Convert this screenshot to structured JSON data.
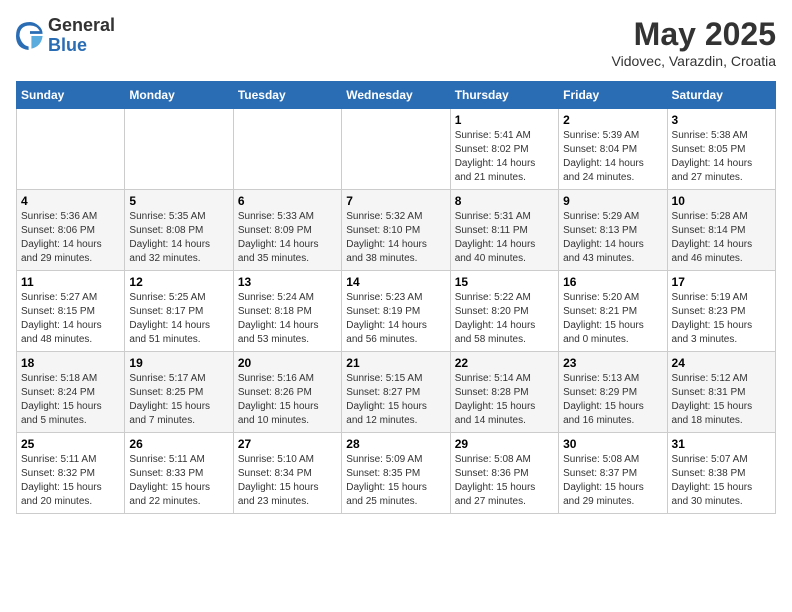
{
  "header": {
    "logo_general": "General",
    "logo_blue": "Blue",
    "month_year": "May 2025",
    "location": "Vidovec, Varazdin, Croatia"
  },
  "days_of_week": [
    "Sunday",
    "Monday",
    "Tuesday",
    "Wednesday",
    "Thursday",
    "Friday",
    "Saturday"
  ],
  "weeks": [
    [
      {
        "day": "",
        "info": ""
      },
      {
        "day": "",
        "info": ""
      },
      {
        "day": "",
        "info": ""
      },
      {
        "day": "",
        "info": ""
      },
      {
        "day": "1",
        "info": "Sunrise: 5:41 AM\nSunset: 8:02 PM\nDaylight: 14 hours and 21 minutes."
      },
      {
        "day": "2",
        "info": "Sunrise: 5:39 AM\nSunset: 8:04 PM\nDaylight: 14 hours and 24 minutes."
      },
      {
        "day": "3",
        "info": "Sunrise: 5:38 AM\nSunset: 8:05 PM\nDaylight: 14 hours and 27 minutes."
      }
    ],
    [
      {
        "day": "4",
        "info": "Sunrise: 5:36 AM\nSunset: 8:06 PM\nDaylight: 14 hours and 29 minutes."
      },
      {
        "day": "5",
        "info": "Sunrise: 5:35 AM\nSunset: 8:08 PM\nDaylight: 14 hours and 32 minutes."
      },
      {
        "day": "6",
        "info": "Sunrise: 5:33 AM\nSunset: 8:09 PM\nDaylight: 14 hours and 35 minutes."
      },
      {
        "day": "7",
        "info": "Sunrise: 5:32 AM\nSunset: 8:10 PM\nDaylight: 14 hours and 38 minutes."
      },
      {
        "day": "8",
        "info": "Sunrise: 5:31 AM\nSunset: 8:11 PM\nDaylight: 14 hours and 40 minutes."
      },
      {
        "day": "9",
        "info": "Sunrise: 5:29 AM\nSunset: 8:13 PM\nDaylight: 14 hours and 43 minutes."
      },
      {
        "day": "10",
        "info": "Sunrise: 5:28 AM\nSunset: 8:14 PM\nDaylight: 14 hours and 46 minutes."
      }
    ],
    [
      {
        "day": "11",
        "info": "Sunrise: 5:27 AM\nSunset: 8:15 PM\nDaylight: 14 hours and 48 minutes."
      },
      {
        "day": "12",
        "info": "Sunrise: 5:25 AM\nSunset: 8:17 PM\nDaylight: 14 hours and 51 minutes."
      },
      {
        "day": "13",
        "info": "Sunrise: 5:24 AM\nSunset: 8:18 PM\nDaylight: 14 hours and 53 minutes."
      },
      {
        "day": "14",
        "info": "Sunrise: 5:23 AM\nSunset: 8:19 PM\nDaylight: 14 hours and 56 minutes."
      },
      {
        "day": "15",
        "info": "Sunrise: 5:22 AM\nSunset: 8:20 PM\nDaylight: 14 hours and 58 minutes."
      },
      {
        "day": "16",
        "info": "Sunrise: 5:20 AM\nSunset: 8:21 PM\nDaylight: 15 hours and 0 minutes."
      },
      {
        "day": "17",
        "info": "Sunrise: 5:19 AM\nSunset: 8:23 PM\nDaylight: 15 hours and 3 minutes."
      }
    ],
    [
      {
        "day": "18",
        "info": "Sunrise: 5:18 AM\nSunset: 8:24 PM\nDaylight: 15 hours and 5 minutes."
      },
      {
        "day": "19",
        "info": "Sunrise: 5:17 AM\nSunset: 8:25 PM\nDaylight: 15 hours and 7 minutes."
      },
      {
        "day": "20",
        "info": "Sunrise: 5:16 AM\nSunset: 8:26 PM\nDaylight: 15 hours and 10 minutes."
      },
      {
        "day": "21",
        "info": "Sunrise: 5:15 AM\nSunset: 8:27 PM\nDaylight: 15 hours and 12 minutes."
      },
      {
        "day": "22",
        "info": "Sunrise: 5:14 AM\nSunset: 8:28 PM\nDaylight: 15 hours and 14 minutes."
      },
      {
        "day": "23",
        "info": "Sunrise: 5:13 AM\nSunset: 8:29 PM\nDaylight: 15 hours and 16 minutes."
      },
      {
        "day": "24",
        "info": "Sunrise: 5:12 AM\nSunset: 8:31 PM\nDaylight: 15 hours and 18 minutes."
      }
    ],
    [
      {
        "day": "25",
        "info": "Sunrise: 5:11 AM\nSunset: 8:32 PM\nDaylight: 15 hours and 20 minutes."
      },
      {
        "day": "26",
        "info": "Sunrise: 5:11 AM\nSunset: 8:33 PM\nDaylight: 15 hours and 22 minutes."
      },
      {
        "day": "27",
        "info": "Sunrise: 5:10 AM\nSunset: 8:34 PM\nDaylight: 15 hours and 23 minutes."
      },
      {
        "day": "28",
        "info": "Sunrise: 5:09 AM\nSunset: 8:35 PM\nDaylight: 15 hours and 25 minutes."
      },
      {
        "day": "29",
        "info": "Sunrise: 5:08 AM\nSunset: 8:36 PM\nDaylight: 15 hours and 27 minutes."
      },
      {
        "day": "30",
        "info": "Sunrise: 5:08 AM\nSunset: 8:37 PM\nDaylight: 15 hours and 29 minutes."
      },
      {
        "day": "31",
        "info": "Sunrise: 5:07 AM\nSunset: 8:38 PM\nDaylight: 15 hours and 30 minutes."
      }
    ]
  ]
}
